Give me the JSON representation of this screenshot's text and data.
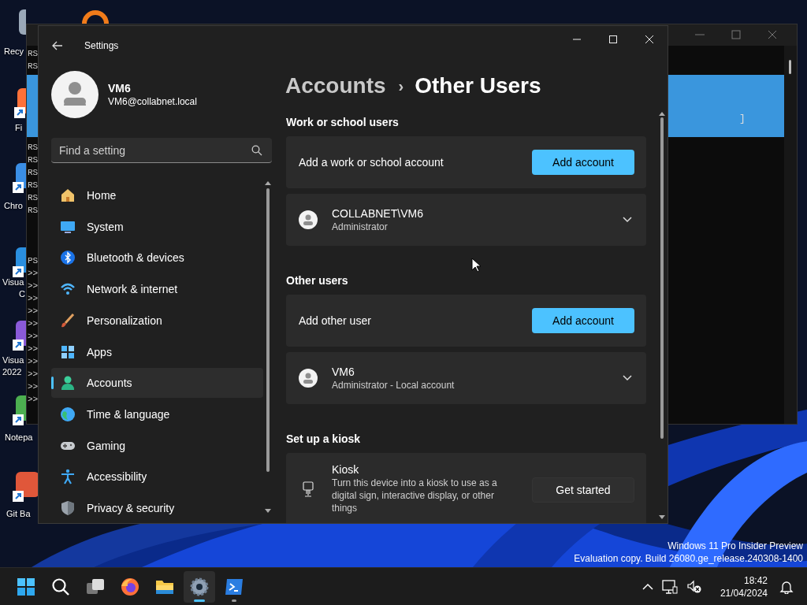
{
  "desktop": {
    "icons": [
      {
        "lines": [
          "Recy"
        ]
      },
      {
        "lines": [
          "Fi"
        ]
      },
      {
        "lines": [
          "Chro"
        ]
      },
      {
        "lines": [
          "Visua",
          "C"
        ]
      },
      {
        "lines": [
          "Visua",
          "2022"
        ]
      },
      {
        "lines": [
          "Notepa"
        ]
      },
      {
        "lines": [
          "Git Ba"
        ]
      }
    ],
    "watermark": [
      "Windows 11 Pro Insider Preview",
      "Evaluation copy. Build 26080.ge_release.240308-1400"
    ]
  },
  "terminal": {
    "top_lines": [
      "RS",
      "RS"
    ],
    "highlight_text": "]",
    "output_lines": [
      "RS",
      "RS",
      "RS",
      "RS",
      "RS",
      "RS"
    ],
    "prompt_lines": [
      "PS",
      ">>",
      ">>",
      ">>",
      ">>",
      ">>",
      ">>",
      ">>",
      ">>",
      ">>",
      ">>",
      ">>"
    ]
  },
  "window": {
    "title": "Settings"
  },
  "profile": {
    "name": "VM6",
    "email": "VM6@collabnet.local"
  },
  "search": {
    "placeholder": "Find a setting"
  },
  "nav": [
    {
      "label": "Home",
      "selected": false
    },
    {
      "label": "System",
      "selected": false
    },
    {
      "label": "Bluetooth & devices",
      "selected": false
    },
    {
      "label": "Network & internet",
      "selected": false
    },
    {
      "label": "Personalization",
      "selected": false
    },
    {
      "label": "Apps",
      "selected": false
    },
    {
      "label": "Accounts",
      "selected": true
    },
    {
      "label": "Time & language",
      "selected": false
    },
    {
      "label": "Gaming",
      "selected": false
    },
    {
      "label": "Accessibility",
      "selected": false
    },
    {
      "label": "Privacy & security",
      "selected": false
    }
  ],
  "breadcrumb": {
    "parent": "Accounts",
    "separator": "›",
    "current": "Other Users"
  },
  "sections": [
    {
      "heading": "Work or school users",
      "cards": [
        {
          "kind": "action",
          "label": "Add a work or school account",
          "button": "Add account"
        },
        {
          "kind": "user",
          "name": "COLLABNET\\VM6",
          "role": "Administrator",
          "expanded": false
        }
      ]
    },
    {
      "heading": "Other users",
      "cards": [
        {
          "kind": "action",
          "label": "Add other user",
          "button": "Add account"
        },
        {
          "kind": "user",
          "name": "VM6",
          "role": "Administrator - Local account",
          "expanded": false
        }
      ]
    },
    {
      "heading": "Set up a kiosk",
      "cards": [
        {
          "kind": "kiosk",
          "label": "Kiosk",
          "description": "Turn this device into a kiosk to use as a digital sign, interactive display, or other things",
          "button": "Get started"
        }
      ]
    }
  ],
  "taskbar": {
    "apps": [
      {
        "selected": false,
        "running": false
      },
      {
        "selected": false,
        "running": false
      },
      {
        "selected": false,
        "running": false
      },
      {
        "selected": false,
        "running": false
      },
      {
        "selected": false,
        "running": false
      },
      {
        "selected": true,
        "running": true
      },
      {
        "selected": false,
        "running": true
      }
    ],
    "time": "18:42",
    "date": "21/04/2024"
  }
}
